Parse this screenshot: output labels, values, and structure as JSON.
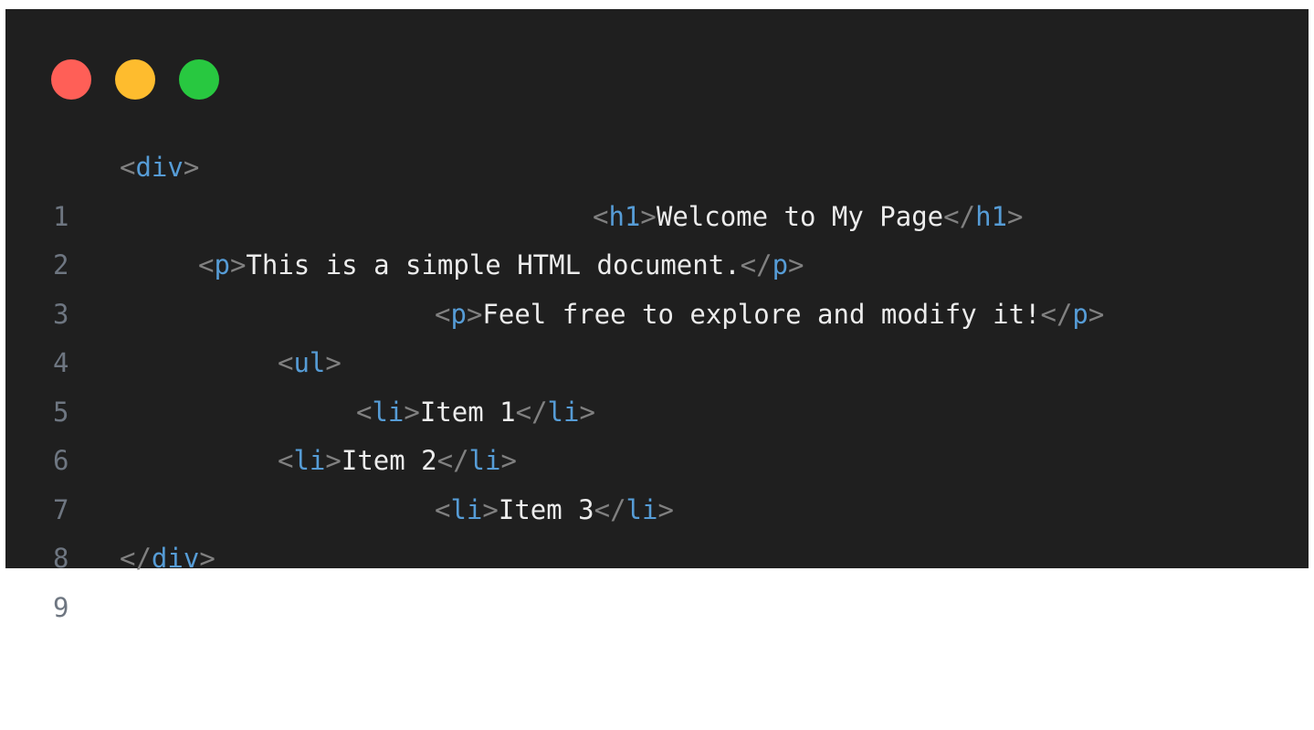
{
  "window": {
    "controls": [
      {
        "name": "close",
        "color": "#ff5f57"
      },
      {
        "name": "minimize",
        "color": "#febc2e"
      },
      {
        "name": "maximize",
        "color": "#28c840"
      }
    ]
  },
  "colors": {
    "background": "#1f1f1f",
    "tag": "#569cd6",
    "bracket": "#808080",
    "text": "#ececec",
    "line_number": "#6e7681"
  },
  "code": {
    "lines": [
      {
        "number": "1",
        "lt": "<",
        "tag": "div",
        "gt": ">",
        "text": "",
        "close_lt": "",
        "close_tag": "",
        "close_gt": ""
      },
      {
        "number": "2",
        "lt": "<",
        "tag": "h1",
        "gt": ">",
        "text": "Welcome to My Page",
        "close_lt": "</",
        "close_tag": "h1",
        "close_gt": ">"
      },
      {
        "number": "3",
        "lt": "<",
        "tag": "p",
        "gt": ">",
        "text": "This is a simple HTML document.",
        "close_lt": "</",
        "close_tag": "p",
        "close_gt": ">"
      },
      {
        "number": "4",
        "lt": "<",
        "tag": "p",
        "gt": ">",
        "text": "Feel free to explore and modify it!",
        "close_lt": "</",
        "close_tag": "p",
        "close_gt": ">"
      },
      {
        "number": "5",
        "lt": "<",
        "tag": "ul",
        "gt": ">",
        "text": "",
        "close_lt": "",
        "close_tag": "",
        "close_gt": ""
      },
      {
        "number": "6",
        "lt": "<",
        "tag": "li",
        "gt": ">",
        "text": "Item 1",
        "close_lt": "</",
        "close_tag": "li",
        "close_gt": ">"
      },
      {
        "number": "7",
        "lt": "<",
        "tag": "li",
        "gt": ">",
        "text": "Item 2",
        "close_lt": "</",
        "close_tag": "li",
        "close_gt": ">"
      },
      {
        "number": "8",
        "lt": "<",
        "tag": "li",
        "gt": ">",
        "text": "Item 3",
        "close_lt": "</",
        "close_tag": "li",
        "close_gt": ">"
      },
      {
        "number": "9",
        "lt": "</",
        "tag": "div",
        "gt": ">",
        "text": "",
        "close_lt": "",
        "close_tag": "",
        "close_gt": ""
      }
    ]
  }
}
